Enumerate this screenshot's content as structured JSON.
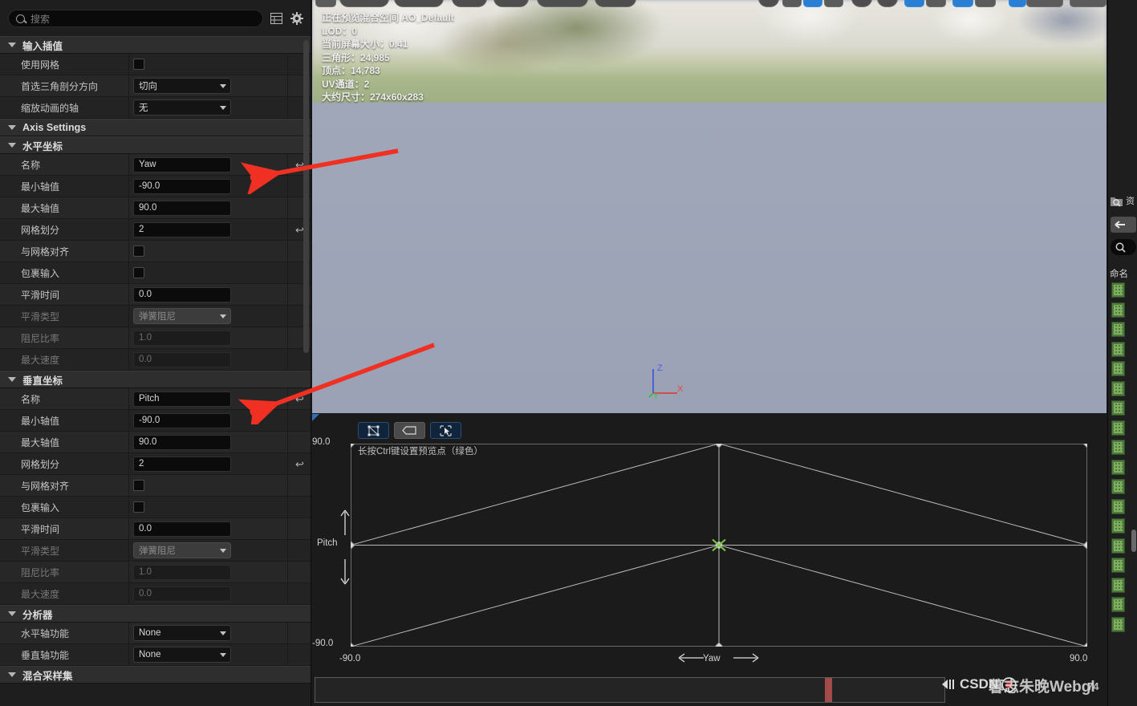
{
  "details": {
    "search": {
      "placeholder": "搜索",
      "icon": "search-icon"
    },
    "header_icons": [
      "table-view-icon",
      "gear-icon"
    ],
    "sections": [
      {
        "id": "input-interp",
        "title": "输入插值",
        "rows": [
          {
            "label": "使用网格",
            "type": "checkbox",
            "value": "",
            "checked": false,
            "reset": false,
            "disabled": false
          },
          {
            "label": "首选三角剖分方向",
            "type": "dropdown",
            "value": "切向",
            "reset": false,
            "disabled": false
          },
          {
            "label": "缩放动画的轴",
            "type": "dropdown",
            "value": "无",
            "reset": false,
            "disabled": false
          }
        ]
      },
      {
        "id": "axis-settings",
        "title": "Axis Settings",
        "rows": []
      },
      {
        "id": "horizontal-axis",
        "title": "水平坐标",
        "rows": [
          {
            "label": "名称",
            "type": "text",
            "value": "Yaw",
            "reset": true,
            "disabled": false
          },
          {
            "label": "最小轴值",
            "type": "text",
            "value": "-90.0",
            "reset": false,
            "disabled": false
          },
          {
            "label": "最大轴值",
            "type": "text",
            "value": "90.0",
            "reset": false,
            "disabled": false
          },
          {
            "label": "网格划分",
            "type": "text",
            "value": "2",
            "reset": true,
            "disabled": false
          },
          {
            "label": "与网格对齐",
            "type": "checkbox",
            "value": "",
            "checked": false,
            "reset": false,
            "disabled": false
          },
          {
            "label": "包裹输入",
            "type": "checkbox",
            "value": "",
            "checked": false,
            "reset": false,
            "disabled": false
          },
          {
            "label": "平滑时间",
            "type": "text",
            "value": "0.0",
            "reset": false,
            "disabled": false
          },
          {
            "label": "平滑类型",
            "type": "dropdown",
            "value": "弹簧阻尼",
            "reset": false,
            "disabled": true
          },
          {
            "label": "阻尼比率",
            "type": "text",
            "value": "1.0",
            "reset": false,
            "disabled": true
          },
          {
            "label": "最大速度",
            "type": "text",
            "value": "0.0",
            "reset": false,
            "disabled": true
          }
        ]
      },
      {
        "id": "vertical-axis",
        "title": "垂直坐标",
        "rows": [
          {
            "label": "名称",
            "type": "text",
            "value": "Pitch",
            "reset": true,
            "disabled": false
          },
          {
            "label": "最小轴值",
            "type": "text",
            "value": "-90.0",
            "reset": false,
            "disabled": false
          },
          {
            "label": "最大轴值",
            "type": "text",
            "value": "90.0",
            "reset": false,
            "disabled": false
          },
          {
            "label": "网格划分",
            "type": "text",
            "value": "2",
            "reset": true,
            "disabled": false
          },
          {
            "label": "与网格对齐",
            "type": "checkbox",
            "value": "",
            "checked": false,
            "reset": false,
            "disabled": false
          },
          {
            "label": "包裹输入",
            "type": "checkbox",
            "value": "",
            "checked": false,
            "reset": false,
            "disabled": false
          },
          {
            "label": "平滑时间",
            "type": "text",
            "value": "0.0",
            "reset": false,
            "disabled": false
          },
          {
            "label": "平滑类型",
            "type": "dropdown",
            "value": "弹簧阻尼",
            "reset": false,
            "disabled": true
          },
          {
            "label": "阻尼比率",
            "type": "text",
            "value": "1.0",
            "reset": false,
            "disabled": true
          },
          {
            "label": "最大速度",
            "type": "text",
            "value": "0.0",
            "reset": false,
            "disabled": true
          }
        ]
      },
      {
        "id": "analyzer",
        "title": "分析器",
        "rows": [
          {
            "label": "水平轴功能",
            "type": "dropdown",
            "value": "None",
            "reset": false,
            "disabled": false
          },
          {
            "label": "垂直轴功能",
            "type": "dropdown",
            "value": "None",
            "reset": false,
            "disabled": false
          }
        ]
      },
      {
        "id": "blend-samples",
        "title": "混合采样集",
        "rows": []
      }
    ]
  },
  "viewport": {
    "overlay": [
      "正在预览混合空间 AO_Default",
      "LOD：0",
      "当前屏幕大小：0.41",
      "三角形：24,985",
      "顶点：14,783",
      "UV通道：2",
      "大约尺寸：274x60x283"
    ],
    "gizmo": {
      "z": "Z",
      "x": "X",
      "y": "Y",
      "z_color": "#3b4fd8",
      "x_color": "#e03232",
      "y_color": "#2fbf2f"
    }
  },
  "graph": {
    "toolbar": [
      {
        "name": "show-triangulation-button",
        "active": true
      },
      {
        "name": "show-labels-button",
        "active": false
      },
      {
        "name": "selection-tool-button",
        "active": true
      }
    ],
    "hint": "长按Ctrl键设置预览点（绿色）",
    "timeline": {
      "playhead_percent": 81
    }
  },
  "chart_data": {
    "type": "scatter",
    "title": "",
    "xlabel": "Yaw",
    "ylabel": "Pitch",
    "xlim": [
      -90.0,
      90.0
    ],
    "ylim": [
      -90.0,
      90.0
    ],
    "x_ticks": [
      "-90.0",
      "90.0"
    ],
    "y_ticks": [
      "90.0",
      "-90.0"
    ],
    "grid": false,
    "legend": "none",
    "sample_points": [
      {
        "x": -90.0,
        "y": 90.0
      },
      {
        "x": 0.0,
        "y": 90.0
      },
      {
        "x": 90.0,
        "y": 90.0
      },
      {
        "x": -90.0,
        "y": 0.0
      },
      {
        "x": 0.0,
        "y": 0.0
      },
      {
        "x": 90.0,
        "y": 0.0
      },
      {
        "x": -90.0,
        "y": -90.0
      },
      {
        "x": 0.0,
        "y": -90.0
      },
      {
        "x": 90.0,
        "y": -90.0
      }
    ],
    "preview_point": {
      "x": 0.0,
      "y": 0.0,
      "color": "#7ac943"
    },
    "triangulation_edges": [
      [
        0,
        1
      ],
      [
        1,
        2
      ],
      [
        3,
        4
      ],
      [
        4,
        5
      ],
      [
        6,
        7
      ],
      [
        7,
        8
      ],
      [
        0,
        3
      ],
      [
        3,
        6
      ],
      [
        1,
        4
      ],
      [
        4,
        7
      ],
      [
        2,
        5
      ],
      [
        5,
        8
      ],
      [
        3,
        1
      ],
      [
        1,
        5
      ],
      [
        6,
        4
      ],
      [
        4,
        8
      ]
    ]
  },
  "right_dock": {
    "tab_label": "资",
    "panel_header": "命名",
    "back_icon": "back-arrow-icon",
    "search_icon": "search-icon",
    "asset_count": 18
  },
  "watermark": {
    "brand": "CSDN",
    "at": "@",
    "user": "暮志朱晚Webgl",
    "suffix": "74"
  }
}
